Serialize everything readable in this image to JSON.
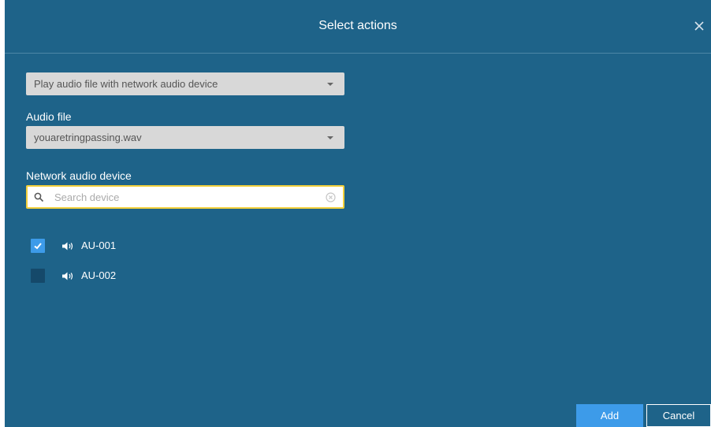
{
  "dialog": {
    "title": "Select actions"
  },
  "action_select": {
    "value": "Play audio file with network audio device"
  },
  "audio_file": {
    "label": "Audio file",
    "value": "youaretringpassing.wav"
  },
  "network_audio": {
    "label": "Network audio device",
    "search_placeholder": "Search device",
    "search_value": ""
  },
  "devices": [
    {
      "name": "AU-001",
      "checked": true
    },
    {
      "name": "AU-002",
      "checked": false
    }
  ],
  "buttons": {
    "add": "Add",
    "cancel": "Cancel"
  },
  "colors": {
    "dialog_bg": "#1e6389",
    "accent": "#3d9be9",
    "search_focus": "#f2cf3b"
  },
  "icons": {
    "close": "close-icon",
    "caret": "chevron-down-icon",
    "search": "search-icon",
    "clear": "clear-icon",
    "speaker": "speaker-icon",
    "check": "check-icon"
  }
}
